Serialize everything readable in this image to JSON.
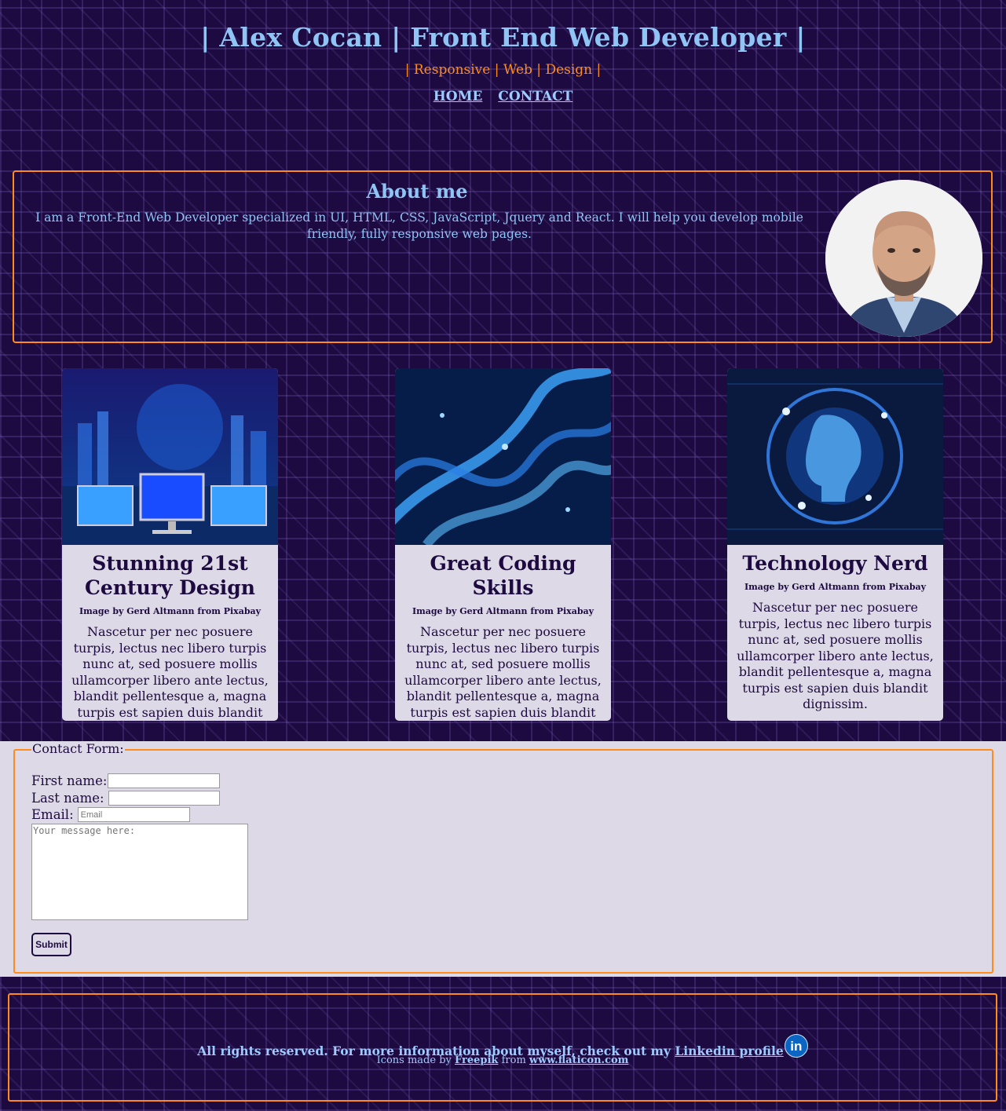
{
  "header": {
    "title": "| Alex Cocan | Front End Web Developer |",
    "tagline": "| Responsive | Web | Design |",
    "nav": [
      {
        "label": "HOME"
      },
      {
        "label": "CONTACT"
      }
    ]
  },
  "about": {
    "title": "About me",
    "text": "I am a Front-End Web Developer specialized in UI, HTML, CSS, JavaScript, Jquery and React. I will help you develop mobile friendly, fully responsive web pages."
  },
  "cards": [
    {
      "title": "Stunning 21st Century Design",
      "credit": "Image by Gerd Altmann from Pixabay",
      "text": "Nascetur per nec posuere turpis, lectus nec libero turpis nunc at, sed posuere mollis ullamcorper libero ante lectus, blandit pellentesque a, magna turpis est sapien duis blandit dignissim."
    },
    {
      "title": "Great Coding Skills",
      "credit": "Image by Gerd Altmann from Pixabay",
      "text": "Nascetur per nec posuere turpis, lectus nec libero turpis nunc at, sed posuere mollis ullamcorper libero ante lectus, blandit pellentesque a, magna turpis est sapien duis blandit dignissim."
    },
    {
      "title": "Technology Nerd",
      "credit": "Image by Gerd Altmann from Pixabay",
      "text": "Nascetur per nec posuere turpis, lectus nec libero turpis nunc at, sed posuere mollis ullamcorper libero ante lectus, blandit pellentesque a, magna turpis est sapien duis blandit dignissim."
    }
  ],
  "contact": {
    "legend": "Contact Form:",
    "first_name_label": "First name:",
    "first_name_value": "",
    "last_name_label": "Last name:",
    "last_name_value": "",
    "email_label": "Email:",
    "email_placeholder": "Email",
    "message_placeholder": "Your message here:",
    "submit_label": "Submit"
  },
  "footer": {
    "main_text": "All rights reserved. For more information about myself, check out my ",
    "linkedin_link": "Linkedin profile",
    "linkedin_icon": "linkedin-icon",
    "linkedin_icon_glyph": "in",
    "icons_text_1": "Icons made by ",
    "icons_author": "Freepik",
    "icons_text_2": " from ",
    "icons_site": "www.flaticon.com"
  },
  "colors": {
    "background": "#1d0a40",
    "accent": "#ff8c1a",
    "link": "#9ecbff",
    "card": "#ded9e6"
  }
}
